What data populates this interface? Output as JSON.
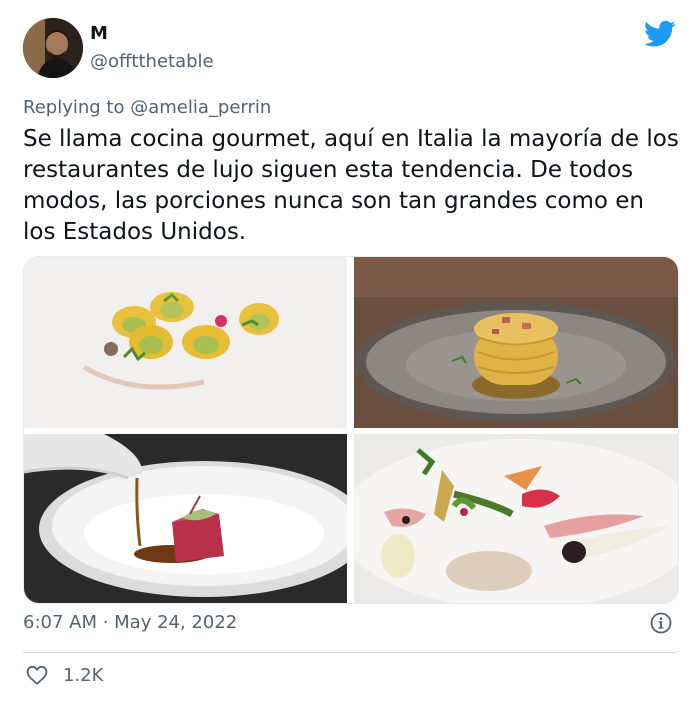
{
  "author": {
    "name": "M",
    "handle": "@offtthetable"
  },
  "reply": {
    "prefix": "Replying to",
    "mention": "@amelia_perrin"
  },
  "tweet_text": "Se llama cocina gourmet, aquí en Italia la mayoría de los restaurantes de lujo siguen esta tendencia. De todos modos, las porciones nunca son tan grandes como en los Estados Unidos.",
  "timestamp": "6:07 AM · May 24, 2022",
  "likes": "1.2K",
  "icons": {
    "platform": "twitter-bird-icon",
    "info": "info-icon",
    "like": "heart-icon"
  },
  "colors": {
    "brand": "#1d9bf0",
    "muted": "#536471",
    "text": "#0f1419"
  },
  "photos": [
    {
      "name": "tortellini-dish-photo"
    },
    {
      "name": "spaghetti-nest-photo"
    },
    {
      "name": "tuna-sauce-pour-photo"
    },
    {
      "name": "vegetable-plate-photo"
    }
  ]
}
